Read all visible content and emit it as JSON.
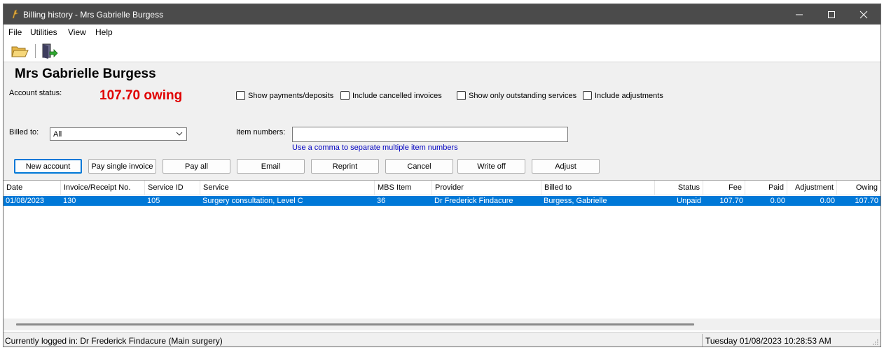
{
  "window": {
    "title": "Billing history - Mrs Gabrielle Burgess",
    "minimize_icon": "minimize-icon",
    "maximize_icon": "maximize-icon",
    "close_icon": "close-icon"
  },
  "menu": [
    "File",
    "Utilities",
    "View",
    "Help"
  ],
  "toolbar": {
    "open_icon": "folder-open-icon",
    "exit_icon": "exit-door-icon"
  },
  "patient": {
    "name": "Mrs Gabrielle Burgess",
    "account_status_label": "Account status:",
    "owing_text": "107.70 owing",
    "owing_color": "#e00000"
  },
  "filters": {
    "show_payments": "Show payments/deposits",
    "include_cancelled": "Include cancelled invoices",
    "show_outstanding": "Show only outstanding services",
    "include_adjustments": "Include adjustments"
  },
  "billed_to": {
    "label": "Billed to:",
    "value": "All"
  },
  "item_numbers": {
    "label": "Item numbers:",
    "value": "",
    "hint": "Use a comma to separate multiple item numbers"
  },
  "buttons": {
    "new_account": "New account",
    "pay_single": "Pay single invoice",
    "pay_all": "Pay all",
    "email": "Email",
    "reprint": "Reprint",
    "cancel": "Cancel",
    "write_off": "Write off",
    "adjust": "Adjust"
  },
  "table": {
    "columns": [
      "Date",
      "Invoice/Receipt No.",
      "Service ID",
      "Service",
      "MBS Item",
      "Provider",
      "Billed to",
      "Status",
      "Fee",
      "Paid",
      "Adjustment",
      "Owing"
    ],
    "rows": [
      [
        "01/08/2023",
        "130",
        "105",
        "Surgery consultation, Level C",
        "36",
        "Dr Frederick Findacure",
        "Burgess, Gabrielle",
        "Unpaid",
        "107.70",
        "0.00",
        "0.00",
        "107.70"
      ]
    ],
    "selected_color": "#0078d7"
  },
  "status": {
    "logged_in": "Currently logged in:  Dr Frederick Findacure (Main surgery)",
    "datetime": "Tuesday 01/08/2023 10:28:53 AM"
  }
}
